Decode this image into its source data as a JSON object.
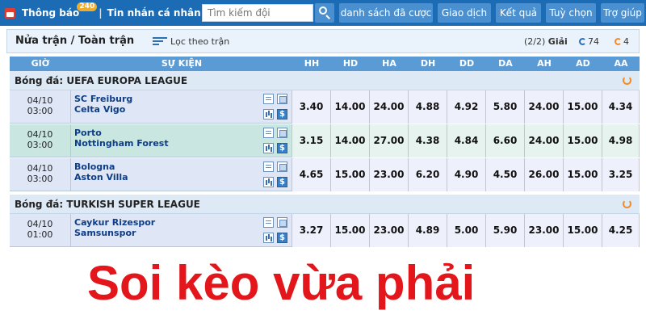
{
  "topbar": {
    "notify_label": "Thông báo",
    "notify_badge": "240",
    "message_label": "Tin nhắn cá nhân",
    "separator": "|",
    "search_placeholder": "Tìm kiếm đội",
    "nav": [
      "danh sách đã cược",
      "Giao dịch",
      "Kết quả",
      "Tuỳ chọn",
      "Trợ giúp"
    ]
  },
  "panel": {
    "title": "Nửa trận / Toàn trận",
    "filter_label": "Lọc theo trận",
    "page": "(2/2)",
    "page_suffix": "Giải",
    "count_a": "74",
    "count_b": "4"
  },
  "table": {
    "headers": [
      "GIỜ",
      "SỰ KIỆN",
      "HH",
      "HD",
      "HA",
      "DH",
      "DD",
      "DA",
      "AH",
      "AD",
      "AA"
    ],
    "leagues": [
      {
        "name": "Bóng đá: UEFA EUROPA LEAGUE",
        "matches": [
          {
            "date": "04/10",
            "time": "03:00",
            "home": "SC Freiburg",
            "away": "Celta Vigo",
            "odds": [
              "3.40",
              "14.00",
              "24.00",
              "4.88",
              "4.92",
              "5.80",
              "24.00",
              "15.00",
              "4.34"
            ]
          },
          {
            "date": "04/10",
            "time": "03:00",
            "home": "Porto",
            "away": "Nottingham Forest",
            "odds": [
              "3.15",
              "14.00",
              "27.00",
              "4.38",
              "4.84",
              "6.60",
              "24.00",
              "15.00",
              "4.98"
            ]
          },
          {
            "date": "04/10",
            "time": "03:00",
            "home": "Bologna",
            "away": "Aston Villa",
            "odds": [
              "4.65",
              "15.00",
              "23.00",
              "6.20",
              "4.90",
              "4.50",
              "26.00",
              "15.00",
              "3.25"
            ]
          }
        ]
      },
      {
        "name": "Bóng đá: TURKISH SUPER LEAGUE",
        "matches": [
          {
            "date": "04/10",
            "time": "01:00",
            "home": "Caykur Rizespor",
            "away": "Samsunspor",
            "odds": [
              "3.27",
              "15.00",
              "23.00",
              "4.89",
              "5.00",
              "5.90",
              "23.00",
              "15.00",
              "4.25"
            ]
          }
        ]
      }
    ],
    "icon_dollar": "$"
  },
  "caption": "Soi kèo vừa phải",
  "colors": {
    "topbar": "#1c6cb5",
    "header": "#5b9bd5",
    "row_blue": "#dfe6f6",
    "row_green": "#c9e6e0",
    "caption": "#e3161b",
    "refresh": "#f28c28"
  }
}
